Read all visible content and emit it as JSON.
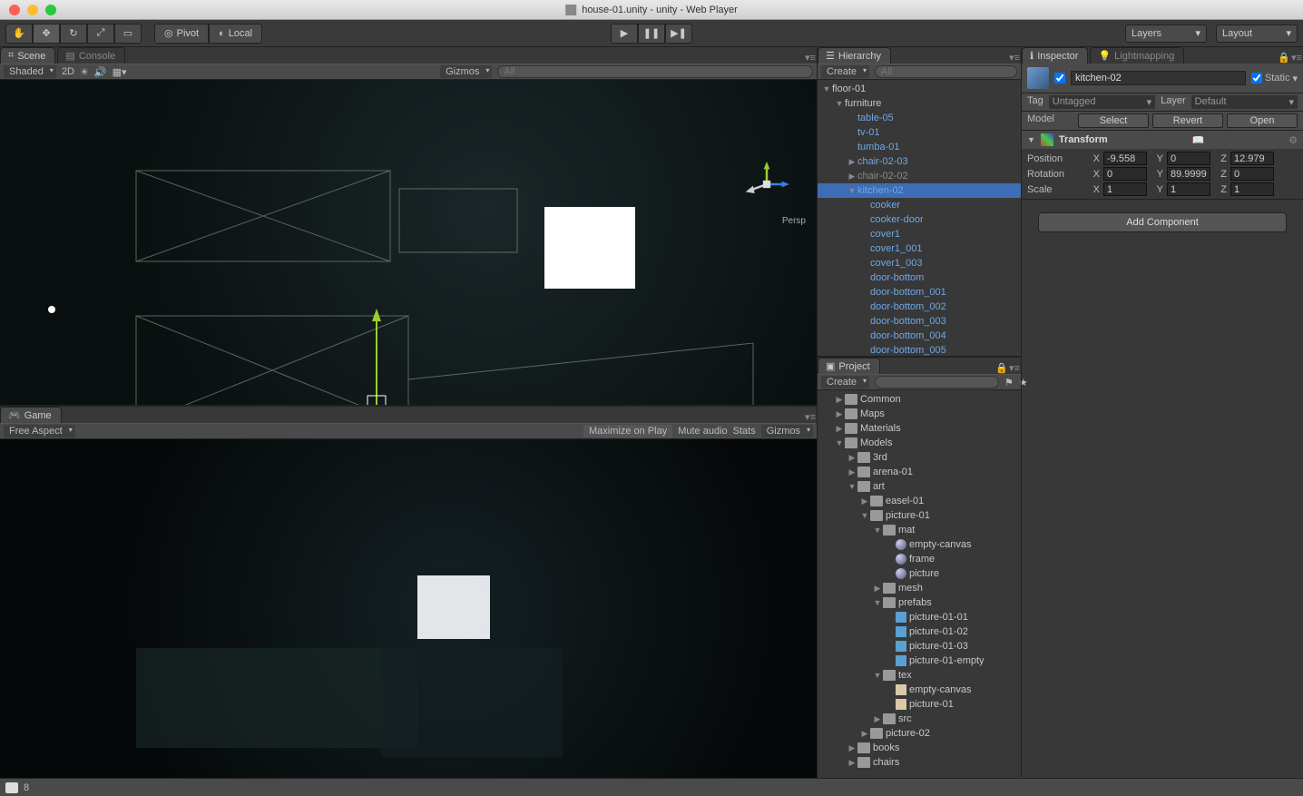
{
  "window": {
    "title": "house-01.unity - unity - Web Player"
  },
  "toolbar": {
    "pivot_center": "Pivot",
    "pivot_rotation": "Local",
    "layers_label": "Layers",
    "layout_label": "Layout"
  },
  "scene": {
    "tab": "Scene",
    "console_tab": "Console",
    "shading_mode": "Shaded",
    "dim_toggle": "2D",
    "gizmos": "Gizmos",
    "search_placeholder": "All",
    "persp": "Persp",
    "axes": {
      "x": "x",
      "y": "y",
      "z": "z"
    }
  },
  "game": {
    "tab": "Game",
    "aspect": "Free Aspect",
    "max_on_play": "Maximize on Play",
    "mute": "Mute audio",
    "stats": "Stats",
    "gizmos": "Gizmos"
  },
  "hierarchy": {
    "tab": "Hierarchy",
    "create": "Create",
    "search_placeholder": "All",
    "items": [
      {
        "indent": 0,
        "arrow": "▼",
        "label": "floor-01",
        "cls": "white"
      },
      {
        "indent": 1,
        "arrow": "▼",
        "label": "furniture",
        "cls": "white"
      },
      {
        "indent": 2,
        "arrow": "",
        "label": "table-05",
        "cls": ""
      },
      {
        "indent": 2,
        "arrow": "",
        "label": "tv-01",
        "cls": ""
      },
      {
        "indent": 2,
        "arrow": "",
        "label": "tumba-01",
        "cls": ""
      },
      {
        "indent": 2,
        "arrow": "▶",
        "label": "chair-02-03",
        "cls": ""
      },
      {
        "indent": 2,
        "arrow": "▶",
        "label": "chair-02-02",
        "cls": "grey"
      },
      {
        "indent": 2,
        "arrow": "▼",
        "label": "kitchen-02",
        "cls": "",
        "selected": true
      },
      {
        "indent": 3,
        "arrow": "",
        "label": "cooker",
        "cls": ""
      },
      {
        "indent": 3,
        "arrow": "",
        "label": "cooker-door",
        "cls": ""
      },
      {
        "indent": 3,
        "arrow": "",
        "label": "cover1",
        "cls": ""
      },
      {
        "indent": 3,
        "arrow": "",
        "label": "cover1_001",
        "cls": ""
      },
      {
        "indent": 3,
        "arrow": "",
        "label": "cover1_003",
        "cls": ""
      },
      {
        "indent": 3,
        "arrow": "",
        "label": "door-bottom",
        "cls": ""
      },
      {
        "indent": 3,
        "arrow": "",
        "label": "door-bottom_001",
        "cls": ""
      },
      {
        "indent": 3,
        "arrow": "",
        "label": "door-bottom_002",
        "cls": ""
      },
      {
        "indent": 3,
        "arrow": "",
        "label": "door-bottom_003",
        "cls": ""
      },
      {
        "indent": 3,
        "arrow": "",
        "label": "door-bottom_004",
        "cls": ""
      },
      {
        "indent": 3,
        "arrow": "",
        "label": "door-bottom_005",
        "cls": ""
      }
    ]
  },
  "project": {
    "tab": "Project",
    "create": "Create",
    "items": [
      {
        "indent": 1,
        "arrow": "▶",
        "icon": "folder",
        "label": "Common"
      },
      {
        "indent": 1,
        "arrow": "▶",
        "icon": "folder",
        "label": "Maps"
      },
      {
        "indent": 1,
        "arrow": "▶",
        "icon": "folder",
        "label": "Materials"
      },
      {
        "indent": 1,
        "arrow": "▼",
        "icon": "folder",
        "label": "Models"
      },
      {
        "indent": 2,
        "arrow": "▶",
        "icon": "folder",
        "label": "3rd"
      },
      {
        "indent": 2,
        "arrow": "▶",
        "icon": "folder",
        "label": "arena-01"
      },
      {
        "indent": 2,
        "arrow": "▼",
        "icon": "folder",
        "label": "art"
      },
      {
        "indent": 3,
        "arrow": "▶",
        "icon": "folder",
        "label": "easel-01"
      },
      {
        "indent": 3,
        "arrow": "▼",
        "icon": "folder",
        "label": "picture-01"
      },
      {
        "indent": 4,
        "arrow": "▼",
        "icon": "folder",
        "label": "mat"
      },
      {
        "indent": 5,
        "arrow": "",
        "icon": "mat",
        "label": "empty-canvas"
      },
      {
        "indent": 5,
        "arrow": "",
        "icon": "mat",
        "label": "frame"
      },
      {
        "indent": 5,
        "arrow": "",
        "icon": "mat",
        "label": "picture"
      },
      {
        "indent": 4,
        "arrow": "▶",
        "icon": "folder",
        "label": "mesh"
      },
      {
        "indent": 4,
        "arrow": "▼",
        "icon": "folder",
        "label": "prefabs"
      },
      {
        "indent": 5,
        "arrow": "",
        "icon": "prefab",
        "label": "picture-01-01"
      },
      {
        "indent": 5,
        "arrow": "",
        "icon": "prefab",
        "label": "picture-01-02"
      },
      {
        "indent": 5,
        "arrow": "",
        "icon": "prefab",
        "label": "picture-01-03"
      },
      {
        "indent": 5,
        "arrow": "",
        "icon": "prefab",
        "label": "picture-01-empty"
      },
      {
        "indent": 4,
        "arrow": "▼",
        "icon": "folder",
        "label": "tex"
      },
      {
        "indent": 5,
        "arrow": "",
        "icon": "tex",
        "label": "empty-canvas"
      },
      {
        "indent": 5,
        "arrow": "",
        "icon": "tex",
        "label": "picture-01"
      },
      {
        "indent": 4,
        "arrow": "▶",
        "icon": "folder",
        "label": "src"
      },
      {
        "indent": 3,
        "arrow": "▶",
        "icon": "folder",
        "label": "picture-02"
      },
      {
        "indent": 2,
        "arrow": "▶",
        "icon": "folder",
        "label": "books"
      },
      {
        "indent": 2,
        "arrow": "▶",
        "icon": "folder",
        "label": "chairs"
      }
    ]
  },
  "inspector": {
    "tab": "Inspector",
    "lightmapping_tab": "Lightmapping",
    "obj_name": "kitchen-02",
    "static": "Static",
    "tag_label": "Tag",
    "tag_value": "Untagged",
    "layer_label": "Layer",
    "layer_value": "Default",
    "model_label": "Model",
    "select_btn": "Select",
    "revert_btn": "Revert",
    "open_btn": "Open",
    "transform": {
      "title": "Transform",
      "position": {
        "label": "Position",
        "x": "-9.558",
        "y": "0",
        "z": "12.979"
      },
      "rotation": {
        "label": "Rotation",
        "x": "0",
        "y": "89.9999",
        "z": "0"
      },
      "scale": {
        "label": "Scale",
        "x": "1",
        "y": "1",
        "z": "1"
      }
    },
    "add_component": "Add Component",
    "axis_x": "X",
    "axis_y": "Y",
    "axis_z": "Z"
  },
  "status": {
    "count": "8"
  }
}
